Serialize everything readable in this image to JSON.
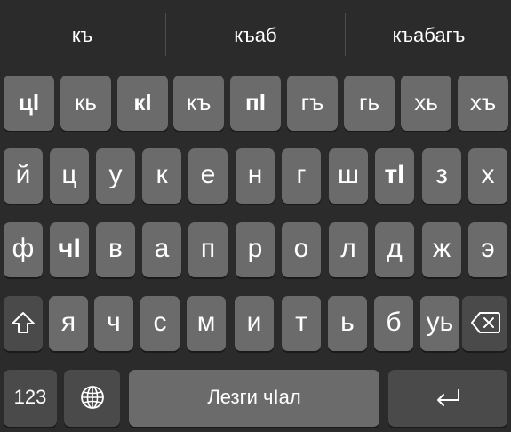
{
  "suggestions": [
    "къ",
    "къаб",
    "къабагъ"
  ],
  "row1": [
    "цӀ",
    "кь",
    "кӀ",
    "къ",
    "пӀ",
    "гъ",
    "гь",
    "хь",
    "хъ"
  ],
  "row2": [
    "й",
    "ц",
    "у",
    "к",
    "е",
    "н",
    "г",
    "ш",
    "тӀ",
    "з",
    "х"
  ],
  "row3": [
    "ф",
    "чӀ",
    "в",
    "а",
    "п",
    "р",
    "о",
    "л",
    "д",
    "ж",
    "э"
  ],
  "row4": [
    "я",
    "ч",
    "с",
    "м",
    "и",
    "т",
    "ь",
    "б",
    "уь"
  ],
  "bottom": {
    "numbers_label": "123",
    "space_label": "Лезги чӀал"
  },
  "icons": {
    "shift": "shift-icon",
    "backspace": "backspace-icon",
    "globe": "globe-icon",
    "return": "return-icon"
  },
  "colors": {
    "background": "#2b2b2b",
    "key": "#6b6b6b",
    "special_key": "#4a4a4a",
    "text": "#ffffff"
  }
}
